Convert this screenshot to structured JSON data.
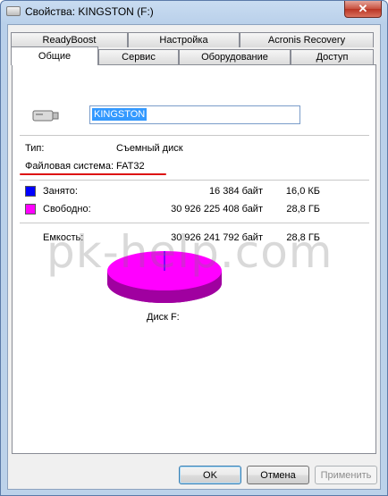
{
  "window": {
    "title": "Свойства: KINGSTON (F:)",
    "close_glyph": "✕"
  },
  "tabs_row1": [
    "ReadyBoost",
    "Настройка",
    "Acronis Recovery"
  ],
  "tabs_row2": [
    "Общие",
    "Сервис",
    "Оборудование",
    "Доступ"
  ],
  "general": {
    "name_value": "KINGSTON",
    "type_label": "Тип:",
    "type_value": "Съемный диск",
    "fs_label": "Файловая система:",
    "fs_value": "FAT32",
    "used_label": "Занято:",
    "used_bytes": "16 384 байт",
    "used_size": "16,0 КБ",
    "free_label": "Свободно:",
    "free_bytes": "30 926 225 408 байт",
    "free_size": "28,8 ГБ",
    "capacity_label": "Емкость:",
    "capacity_bytes": "30 926 241 792 байт",
    "capacity_size": "28,8 ГБ",
    "disk_label": "Диск F:"
  },
  "colors": {
    "used": "#0000ff",
    "free": "#ff00ff",
    "pie_side": "#a000a0",
    "fs_underline": "#dd1111"
  },
  "buttons": {
    "ok": "OK",
    "cancel": "Отмена",
    "apply": "Применить"
  },
  "watermark": "pk-help.com"
}
